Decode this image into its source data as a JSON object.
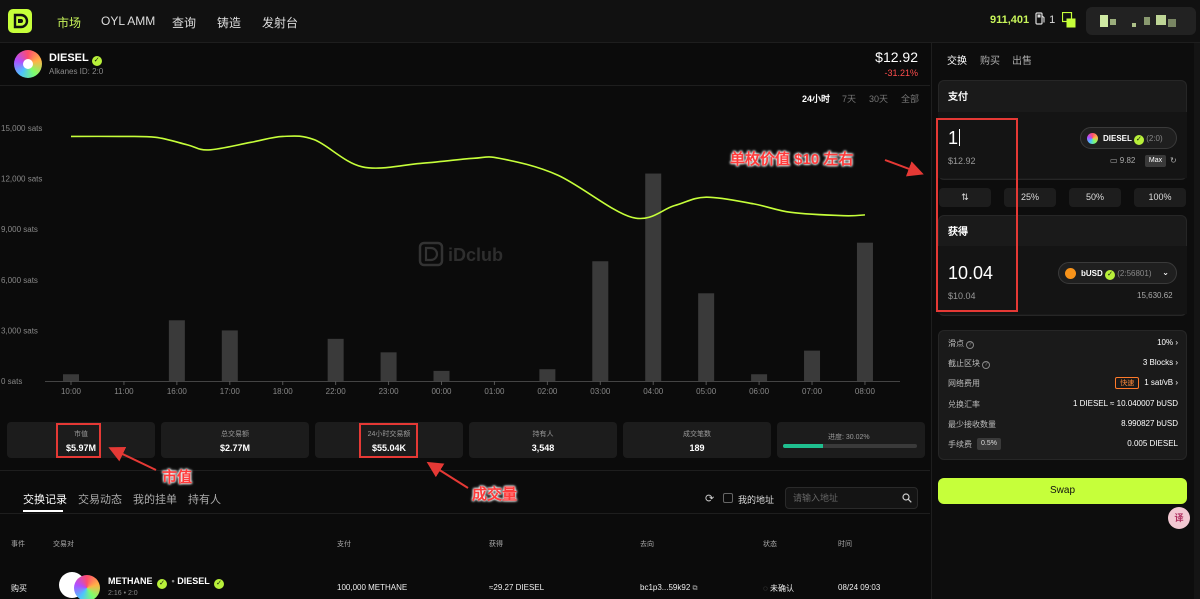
{
  "nav": {
    "items": [
      "市场",
      "OYL AMM",
      "查询",
      "铸造",
      "发射台"
    ],
    "balance": "911,401",
    "gas": "1"
  },
  "token": {
    "name": "DIESEL",
    "id_label": "Alkanes ID: 2:0",
    "price": "$12.92",
    "change": "-31.21%"
  },
  "range_tabs": [
    "24小时",
    "7天",
    "30天",
    "全部"
  ],
  "chart_data": {
    "type": "bar",
    "watermark": "iDclub",
    "categories": [
      "10:00",
      "11:00",
      "16:00",
      "17:00",
      "18:00",
      "22:00",
      "23:00",
      "00:00",
      "01:00",
      "02:00",
      "03:00",
      "04:00",
      "05:00",
      "06:00",
      "07:00",
      "08:00"
    ],
    "y_ticks": [
      "0 sats",
      "3,000 sats",
      "6,000 sats",
      "9,000 sats",
      "12,000 sats",
      "15,000 sats"
    ],
    "ylim": [
      0,
      15000
    ],
    "bar_series": [
      400,
      0,
      3600,
      3000,
      0,
      2500,
      1700,
      600,
      0,
      700,
      7100,
      12300,
      5200,
      400,
      1800,
      8200
    ],
    "line_series": {
      "x": [
        0,
        0.9,
        1.6,
        2.2,
        2.6,
        3.4,
        4.0,
        4.6,
        5.5,
        6.6,
        7.6,
        8.1,
        9.2,
        10.6,
        11.4,
        12.0,
        12.9,
        13.6,
        14.6,
        15.0
      ],
      "y": [
        14500,
        14500,
        14450,
        14000,
        13700,
        14150,
        14500,
        14300,
        12700,
        12900,
        13200,
        13200,
        12200,
        9700,
        10400,
        10900,
        10500,
        10000,
        9800,
        9850
      ]
    },
    "grid": false,
    "bar_color": "#3a3a3a",
    "line_color": "#c6ff3a"
  },
  "stats": [
    {
      "label": "市值",
      "value": "$5.97M"
    },
    {
      "label": "总交易额",
      "value": "$2.77M"
    },
    {
      "label": "24小时交易额",
      "value": "$55.04K"
    },
    {
      "label": "持有人",
      "value": "3,548"
    },
    {
      "label": "成交笔数",
      "value": "189"
    }
  ],
  "progress": {
    "label": "进度: 30.02%",
    "fraction": 0.3002
  },
  "bottom_tabs": [
    "交换记录",
    "交易动态",
    "我的挂单",
    "持有人"
  ],
  "filter": {
    "mine_label": "我的地址",
    "placeholder": "请输入地址"
  },
  "table": {
    "headers": [
      "事件",
      "交易对",
      "支付",
      "获得",
      "去向",
      "状态",
      "时间"
    ],
    "row": {
      "event": "购买",
      "pair_a": "METHANE",
      "pair_b": "DIESEL",
      "pair_sub": "2:16  •  2:0",
      "pay": "100,000 METHANE",
      "get": "≈29.27 DIESEL",
      "to": "bc1p3...59k92",
      "status": "未确认",
      "time": "08/24 09:03"
    }
  },
  "swap": {
    "tabs": [
      "交换",
      "购买",
      "出售"
    ],
    "pay_title": "支付",
    "pay_amount": "1",
    "pay_usd": "$12.92",
    "pay_token": "DIESEL",
    "pay_token_id": "(2:0)",
    "pay_balance": "9.82",
    "max_label": "Max",
    "pct_buttons": [
      "25%",
      "50%",
      "100%"
    ],
    "get_title": "获得",
    "get_amount": "10.04",
    "get_usd": "$10.04",
    "get_token": "bUSD",
    "get_token_id": "(2:56801)",
    "get_balance": "15,630.62",
    "info": [
      {
        "label": "滑点",
        "value": "10%"
      },
      {
        "label": "截止区块",
        "value": "3 Blocks"
      },
      {
        "label": "网络费用",
        "tag": "快速",
        "value": "1 sat/vB"
      },
      {
        "label": "兑换汇率",
        "value": "1 DIESEL ≈ 10.040007 bUSD"
      },
      {
        "label": "最少接收数量",
        "value": "8.990827 bUSD"
      },
      {
        "label": "手续费",
        "badge": "0.5%",
        "value": "0.005 DIESEL"
      }
    ],
    "swap_label": "Swap"
  },
  "annotations": {
    "price_note": "单枚价值 $10 左右",
    "mcap_note": "市值",
    "volume_note": "成交量"
  },
  "float_icon": "译"
}
